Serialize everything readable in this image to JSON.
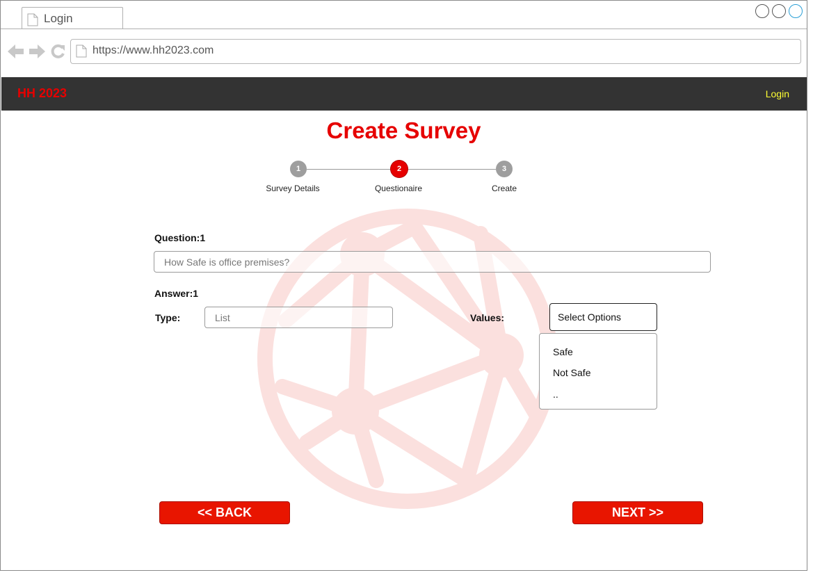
{
  "browser": {
    "tab_title": "Login",
    "url": "https://www.hh2023.com"
  },
  "header": {
    "brand": "HH 2023",
    "login_label": "Login"
  },
  "page": {
    "title": "Create Survey"
  },
  "stepper": {
    "steps": [
      {
        "number": "1",
        "label": "Survey Details",
        "state": "inactive"
      },
      {
        "number": "2",
        "label": "Questionaire",
        "state": "active"
      },
      {
        "number": "3",
        "label": "Create",
        "state": "inactive"
      }
    ]
  },
  "form": {
    "question_label": "Question:1",
    "question_placeholder": "How Safe is office premises?",
    "answer_label": "Answer:1",
    "type_label": "Type:",
    "type_placeholder": "List",
    "values_label": "Values:",
    "values_select": "Select Options",
    "values_options": [
      "Safe",
      "Not Safe",
      ".."
    ]
  },
  "buttons": {
    "back": "<<  BACK",
    "next": "NEXT >>"
  },
  "colors": {
    "accent": "#e60000",
    "header_bg": "#333333",
    "login_link": "#ffff33",
    "step_inactive": "#9e9e9e",
    "step_active": "#e60000",
    "button_bg": "#e81500"
  }
}
